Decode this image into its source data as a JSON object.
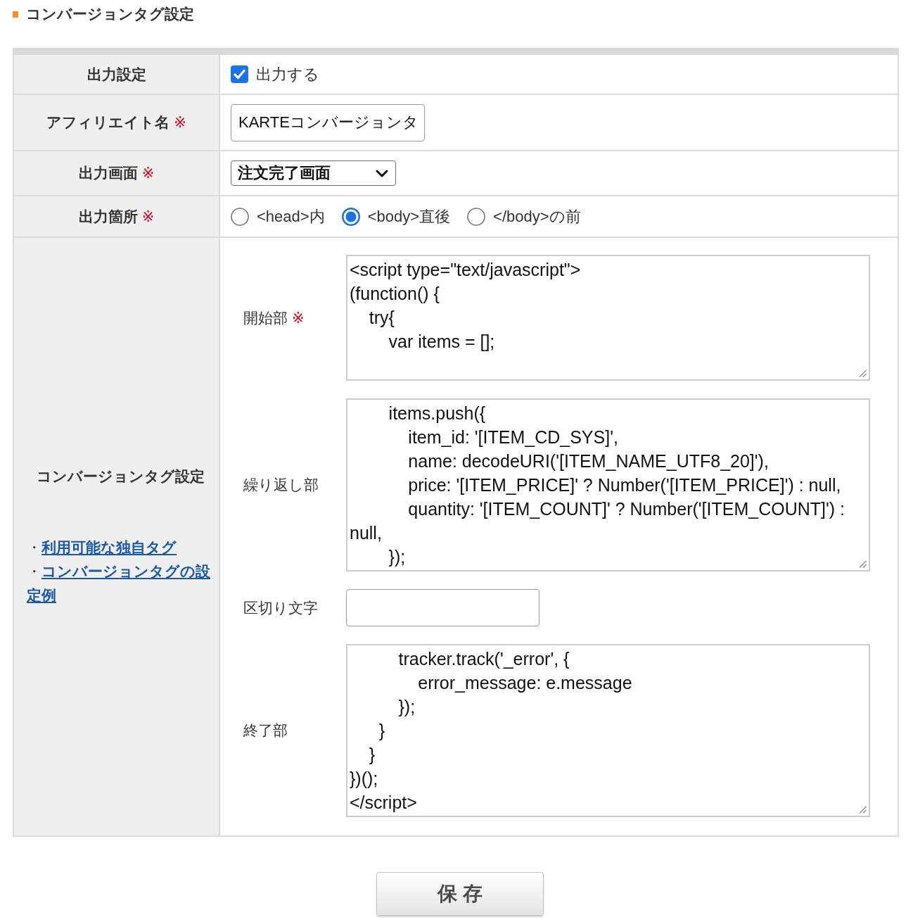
{
  "section_title": "コンバージョンタグ設定",
  "form": {
    "rows": [
      {
        "kind": "checkbox",
        "label": "出力設定",
        "checkbox": {
          "label": "出力する",
          "checked": true
        }
      },
      {
        "kind": "text",
        "label": "アフィリエイト名",
        "mark": "※",
        "value": "KARTEコンバージョンタ"
      },
      {
        "kind": "select",
        "label": "出力画面",
        "mark": "※",
        "value": "注文完了画面"
      },
      {
        "kind": "radio",
        "label": "出力箇所",
        "mark": "※",
        "options": [
          {
            "label": "<head>内",
            "selected": false
          },
          {
            "label": "<body>直後",
            "selected": true
          },
          {
            "label": "</body>の前",
            "selected": false
          }
        ]
      },
      {
        "kind": "group",
        "label": "コンバージョンタグ設定",
        "links": [
          {
            "bullet": "・",
            "label": "利用可能な独自タグ"
          },
          {
            "bullet": "・",
            "label": "コンバージョンタグの設定例"
          }
        ],
        "fields": [
          {
            "kind": "code",
            "label": "開始部",
            "mark": "※",
            "value": "<script type=\"text/javascript\">\n(function() {\n    try{\n        var items = [];"
          },
          {
            "kind": "code",
            "label": "繰り返し部",
            "value": "        items.push({\n            item_id: '[ITEM_CD_SYS]',\n            name: decodeURI('[ITEM_NAME_UTF8_20]'),\n            price: '[ITEM_PRICE]' ? Number('[ITEM_PRICE]') : null,\n            quantity: '[ITEM_COUNT]' ? Number('[ITEM_COUNT]') : null,\n        });"
          },
          {
            "kind": "text",
            "label": "区切り文字"
          },
          {
            "kind": "code",
            "label": "終了部",
            "value": "          tracker.track('_error', {\n              error_message: e.message\n          });\n      }\n    }\n})();\n</script>"
          }
        ]
      }
    ]
  },
  "save_button": "保 存"
}
